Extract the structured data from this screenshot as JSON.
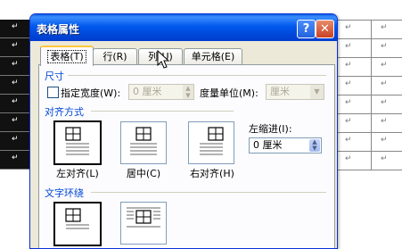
{
  "dialog": {
    "title": "表格属性",
    "help_glyph": "?",
    "close_glyph": "✕"
  },
  "tabs": [
    {
      "label": "表格(T)",
      "active": true
    },
    {
      "label": "行(R)",
      "active": false
    },
    {
      "label": "列(U)",
      "active": false
    },
    {
      "label": "单元格(E)",
      "active": false
    }
  ],
  "size": {
    "group_label": "尺寸",
    "specify_width_label": "指定宽度(W):",
    "width_value": "0 厘米",
    "unit_label": "度量单位(M):",
    "unit_value": "厘米"
  },
  "alignment": {
    "group_label": "对齐方式",
    "options": [
      "左对齐(L)",
      "居中(C)",
      "右对齐(H)"
    ],
    "indent_label": "左缩进(I):",
    "indent_value": "0 厘米"
  },
  "text_wrapping": {
    "group_label": "文字环绕"
  },
  "document": {
    "paragraph_mark": "↵"
  }
}
